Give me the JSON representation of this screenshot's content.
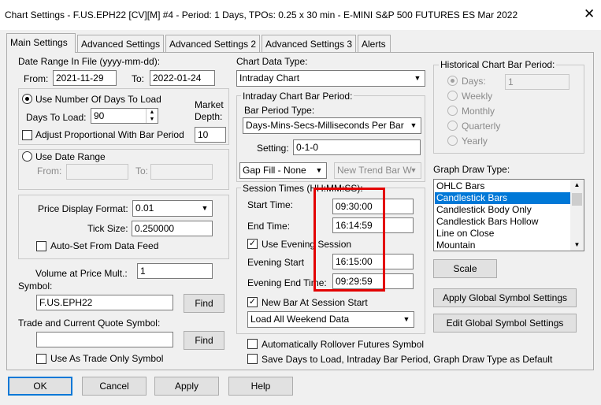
{
  "title": "Chart Settings - F.US.EPH22 [CV][M]  #4 - Period: 1 Days, TPOs: 0.25 x 30 min   - E-MINI S&P 500 FUTURES ES Mar 2022",
  "tabs": [
    "Main Settings",
    "Advanced Settings",
    "Advanced Settings 2",
    "Advanced Settings 3",
    "Alerts"
  ],
  "date_range": {
    "label": "Date Range In File (yyyy-mm-dd):",
    "from_label": "From:",
    "from_value": "2021-11-29",
    "to_label": "To:",
    "to_value": "2022-01-24"
  },
  "days_group": {
    "use_days_label": "Use Number Of Days To Load",
    "days_label": "Days To Load:",
    "days_value": "90",
    "market_depth_label_1": "Market",
    "market_depth_label_2": "Depth:",
    "market_depth_value": "10",
    "adjust_label": "Adjust Proportional With Bar Period",
    "use_days_selected": true,
    "adjust_checked": false
  },
  "date_group": {
    "use_date_label": "Use Date Range",
    "from_label": "From:",
    "to_label": "To:"
  },
  "price_group": {
    "format_label": "Price Display Format:",
    "format_value": "0.01",
    "tick_label": "Tick Size:",
    "tick_value": "0.250000",
    "autoset_label": "Auto-Set From Data Feed",
    "autoset_checked": false
  },
  "volume": {
    "label": "Volume at Price Mult.:",
    "value": "1"
  },
  "symbol": {
    "label": "Symbol:",
    "value": "F.US.EPH22",
    "find_label": "Find"
  },
  "trade_symbol": {
    "label": "Trade and Current Quote Symbol:",
    "value": "",
    "find_label": "Find",
    "trade_only_label": "Use As Trade Only Symbol",
    "trade_only_checked": false
  },
  "chart_data_type": {
    "label": "Chart Data Type:",
    "value": "Intraday Chart"
  },
  "intraday": {
    "group_label": "Intraday Chart Bar Period:",
    "bar_period_type_label": "Bar Period Type:",
    "bar_period_type_value": "Days-Mins-Secs-Milliseconds Per Bar",
    "setting_label": "Setting:",
    "setting_value": "0-1-0",
    "gap_fill_value": "Gap Fill - None",
    "new_trend_value": "New Trend Bar W"
  },
  "session": {
    "group_label": "Session Times (HH:MM:SS):",
    "start_label": "Start Time:",
    "start_value": "09:30:00",
    "end_label": "End Time:",
    "end_value": "16:14:59",
    "use_evening_label": "Use Evening Session",
    "use_evening_checked": true,
    "evening_start_label": "Evening Start",
    "evening_start_value": "16:15:00",
    "evening_end_label": "Evening End Time:",
    "evening_end_value": "09:29:59",
    "new_bar_label": "New Bar At Session Start",
    "new_bar_checked": true,
    "weekend_value": "Load All Weekend Data"
  },
  "historical": {
    "label": "Historical Chart Bar Period:",
    "options": [
      "Days:",
      "Weekly",
      "Monthly",
      "Quarterly",
      "Yearly"
    ],
    "days_value": "1"
  },
  "graph_draw": {
    "label": "Graph Draw Type:",
    "items": [
      "OHLC Bars",
      "Candlestick Bars",
      "Candlestick Body Only",
      "Candlestick Bars Hollow",
      "Line on Close",
      "Mountain"
    ],
    "selected": "Candlestick Bars"
  },
  "buttons": {
    "scale": "Scale",
    "apply_global": "Apply Global Symbol Settings",
    "edit_global": "Edit Global Symbol Settings",
    "ok": "OK",
    "cancel": "Cancel",
    "apply": "Apply",
    "help": "Help"
  },
  "bottom_checks": {
    "rollover_label": "Automatically Rollover Futures Symbol",
    "rollover_checked": false,
    "save_label": "Save Days to Load, Intraday Bar Period, Graph Draw Type as Default",
    "save_checked": false
  },
  "colors": {
    "highlight": "#0078d7",
    "annotation_red": "#e30000"
  }
}
